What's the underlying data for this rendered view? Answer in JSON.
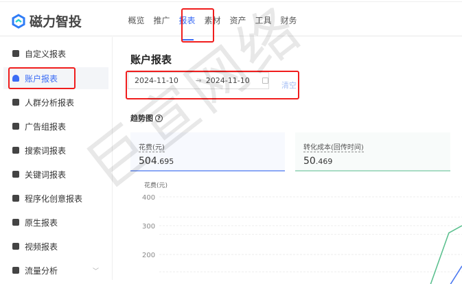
{
  "app": {
    "name": "磁力智投"
  },
  "nav": {
    "items": [
      "概览",
      "推广",
      "报表",
      "素材",
      "资产",
      "工具",
      "财务"
    ],
    "active": 2
  },
  "sidebar": {
    "items": [
      "自定义报表",
      "账户报表",
      "人群分析报表",
      "广告组报表",
      "搜索词报表",
      "关键词报表",
      "程序化创意报表",
      "原生报表",
      "视频报表",
      "流量分析"
    ],
    "active": 1
  },
  "main": {
    "title": "账户报表",
    "date_start": "2024-11-10",
    "date_sep": "→",
    "date_end": "2024-11-10",
    "clear": "清空",
    "trend": "趋势图",
    "help": "?",
    "cards": [
      {
        "label": "花费(元)",
        "int": "504",
        "dec": ".695",
        "color": "#8aa8f5"
      },
      {
        "label": "转化成本(回传时间)",
        "int": "50",
        "dec": ".469",
        "color": "#a8dcc4"
      }
    ]
  },
  "chart_data": {
    "type": "line",
    "ylabel": "花费(元)",
    "yticks": [
      "400",
      "300",
      "200"
    ],
    "ylim": [
      100,
      400
    ],
    "series": [
      {
        "name": "花费(元)",
        "color": "#4a78f0",
        "x": [
          22.1,
          23
        ],
        "values": [
          95,
          160
        ]
      },
      {
        "name": "转化成本(回传时间)",
        "color": "#5cc08f",
        "x": [
          20.6,
          22,
          23
        ],
        "values": [
          95,
          275,
          300
        ]
      }
    ],
    "xlim": [
      0,
      23
    ]
  },
  "watermark": "巨宣网络"
}
